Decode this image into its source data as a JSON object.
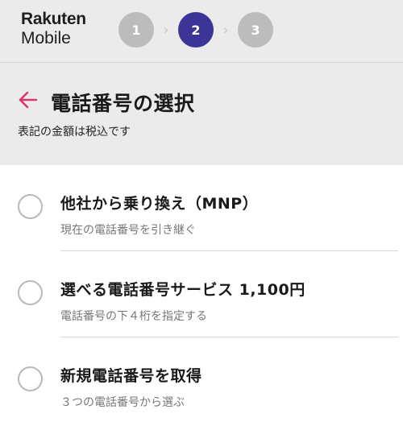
{
  "header": {
    "logo": {
      "brand": "Rakuten",
      "product": "Mobile"
    },
    "steps": [
      {
        "label": "1",
        "active": false
      },
      {
        "label": "2",
        "active": true
      },
      {
        "label": "3",
        "active": false
      }
    ],
    "step_separator": "›",
    "active_color": "#3a3596",
    "inactive_color": "#bcbcbc"
  },
  "page": {
    "title": "電話番号の選択",
    "tax_note": "表記の金額は税込です",
    "back_icon": "back-arrow-icon",
    "accent_color": "#e0336e"
  },
  "options": [
    {
      "title": "他社から乗り換え（MNP）",
      "subtitle": "現在の電話番号を引き継ぐ",
      "selected": false
    },
    {
      "title": "選べる電話番号サービス 1,100円",
      "subtitle": "電話番号の下４桁を指定する",
      "selected": false
    },
    {
      "title": "新規電話番号を取得",
      "subtitle": "３つの電話番号から選ぶ",
      "selected": false
    }
  ]
}
